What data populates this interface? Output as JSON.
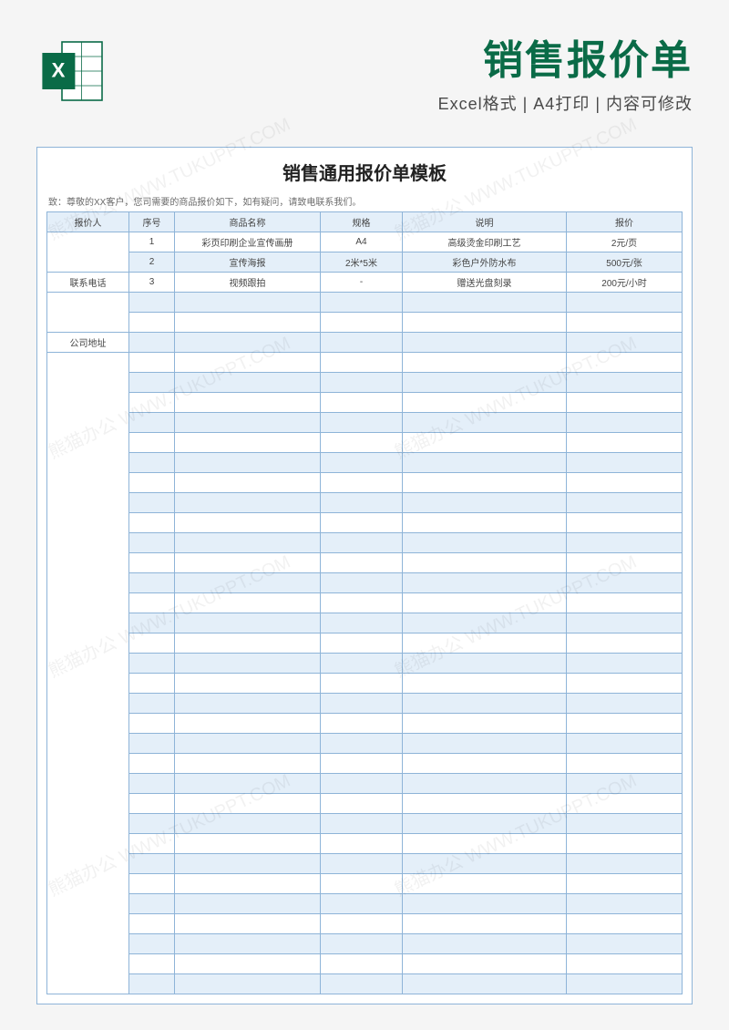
{
  "header": {
    "main_title": "销售报价单",
    "subtitle": "Excel格式 | A4打印 | 内容可修改"
  },
  "form": {
    "title": "销售通用报价单模板",
    "intro": "致：尊敬的XX客户，您司需要的商品报价如下，如有疑问，请致电联系我们。",
    "left_labels": {
      "quoter": "报价人",
      "phone": "联系电话",
      "address": "公司地址"
    },
    "columns": {
      "seq": "序号",
      "name": "商品名称",
      "spec": "规格",
      "desc": "说明",
      "price": "报价"
    },
    "rows": [
      {
        "seq": "1",
        "name": "彩页印刷企业宣传画册",
        "spec": "A4",
        "desc": "高级烫金印刷工艺",
        "price": "2元/页"
      },
      {
        "seq": "2",
        "name": "宣传海报",
        "spec": "2米*5米",
        "desc": "彩色户外防水布",
        "price": "500元/张"
      },
      {
        "seq": "3",
        "name": "视频跟拍",
        "spec": "-",
        "desc": "赠送光盘刻录",
        "price": "200元/小时"
      }
    ]
  },
  "watermark": "熊猫办公 WWW.TUKUPPT.COM"
}
